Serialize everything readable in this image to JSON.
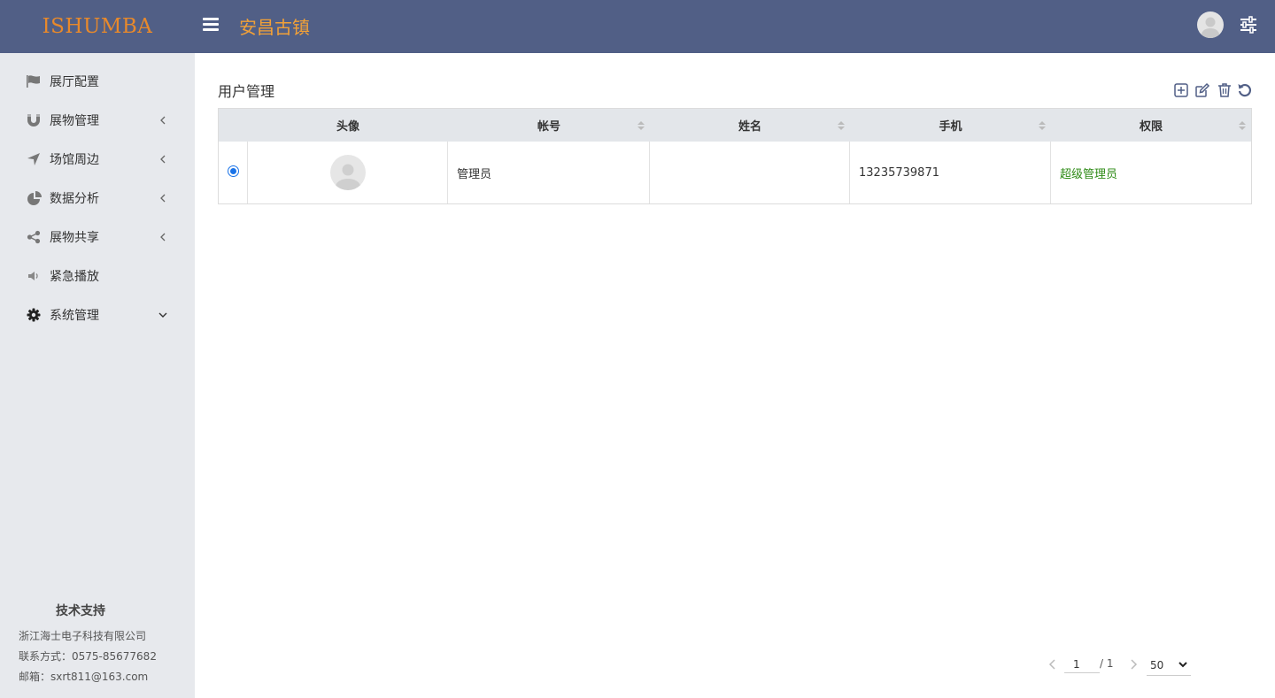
{
  "header": {
    "logo": "ISHUMBA",
    "site_title": "安昌古镇"
  },
  "sidebar": {
    "items": [
      {
        "label": "展厅配置",
        "icon": "flag-icon",
        "has_chevron": false
      },
      {
        "label": "展物管理",
        "icon": "magnet-icon",
        "has_chevron": true
      },
      {
        "label": "场馆周边",
        "icon": "location-arrow-icon",
        "has_chevron": true
      },
      {
        "label": "数据分析",
        "icon": "pie-chart-icon",
        "has_chevron": true
      },
      {
        "label": "展物共享",
        "icon": "share-icon",
        "has_chevron": true
      },
      {
        "label": "紧急播放",
        "icon": "volume-icon",
        "has_chevron": false
      },
      {
        "label": "系统管理",
        "icon": "gear-icon",
        "has_chevron": true,
        "expanded": true
      }
    ],
    "support": {
      "title": "技术支持",
      "company": "浙江海士电子科技有限公司",
      "contact": "联系方式：0575-85677682",
      "email": "邮箱：sxrt811@163.com"
    }
  },
  "main": {
    "title": "用户管理",
    "toolbar": [
      "add-icon",
      "edit-icon",
      "delete-icon",
      "refresh-icon"
    ],
    "table": {
      "columns": [
        "头像",
        "帐号",
        "姓名",
        "手机",
        "权限"
      ],
      "rows": [
        {
          "account": "管理员",
          "name": "",
          "phone": "13235739871",
          "role": "超级管理员",
          "selected": true
        }
      ]
    },
    "pagination": {
      "current": "1",
      "total": "/ 1",
      "page_size": "50"
    }
  },
  "colors": {
    "header_bg": "#515f86",
    "logo": "#e8892b",
    "site_title": "#f1a038",
    "sidebar_bg": "#e7e9ed",
    "table_header_bg": "#e3e6ea",
    "role_text": "#2e8b16",
    "radio": "#1a73e8"
  }
}
